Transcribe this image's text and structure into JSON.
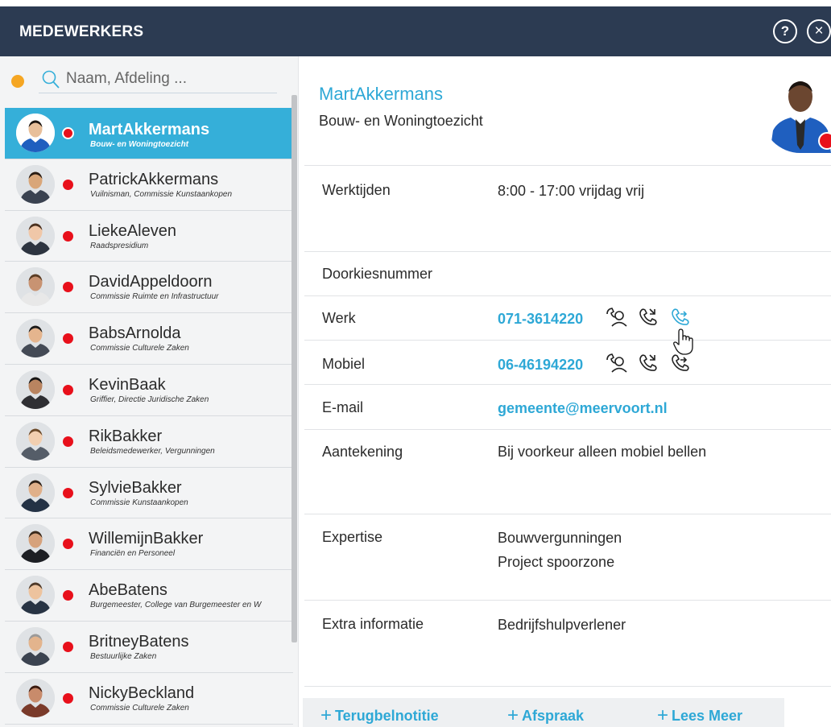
{
  "header": {
    "title": "MEDEWERKERS",
    "help_icon": "question-icon",
    "close_icon": "close-icon",
    "help_glyph": "?",
    "close_glyph": "×"
  },
  "search": {
    "placeholder": "Naam, Afdeling ...",
    "status_color": "#f5a623"
  },
  "employees": [
    {
      "name": "MartAkkermans",
      "role": "Bouw- en Woningtoezicht",
      "selected": true,
      "avatar": "person-avatar-1"
    },
    {
      "name": "PatrickAkkermans",
      "role": "Vuilnisman, Commissie Kunstaankopen",
      "avatar": "person-avatar-2"
    },
    {
      "name": "LiekeAleven",
      "role": "Raadspresidium",
      "avatar": "person-avatar-3"
    },
    {
      "name": "DavidAppeldoorn",
      "role": "Commissie Ruimte en Infrastructuur",
      "avatar": "person-avatar-4"
    },
    {
      "name": "BabsArnolda",
      "role": "Commissie Culturele Zaken",
      "avatar": "person-avatar-5"
    },
    {
      "name": "KevinBaak",
      "role": "Griffier, Directie Juridische Zaken",
      "avatar": "person-avatar-6"
    },
    {
      "name": "RikBakker",
      "role": "Beleidsmedewerker, Vergunningen",
      "avatar": "person-avatar-7"
    },
    {
      "name": "SylvieBakker",
      "role": "Commissie Kunstaankopen",
      "avatar": "person-avatar-8"
    },
    {
      "name": "WillemijnBakker",
      "role": "Financiën en Personeel",
      "avatar": "person-avatar-9"
    },
    {
      "name": "AbeBatens",
      "role": "Burgemeester, College van Burgemeester en W",
      "avatar": "person-avatar-10"
    },
    {
      "name": "BritneyBatens",
      "role": "Bestuurlijke Zaken",
      "avatar": "person-avatar-11"
    },
    {
      "name": "NickyBeckland",
      "role": "Commissie Culturele Zaken",
      "avatar": "person-avatar-12"
    }
  ],
  "detail": {
    "name": "MartAkkermans",
    "department": "Bouw- en Woningtoezicht",
    "fields": {
      "werktijden": {
        "label": "Werktijden",
        "value": "8:00 - 17:00 vrijdag vrij"
      },
      "doorkies": {
        "label": "Doorkiesnummer"
      },
      "werk": {
        "label": "Werk",
        "value": "071-3614220"
      },
      "mobiel": {
        "label": "Mobiel",
        "value": "06-46194220"
      },
      "email": {
        "label": "E-mail",
        "value": "gemeente@meervoort.nl"
      },
      "aantekening": {
        "label": "Aantekening",
        "value": "Bij voorkeur alleen mobiel bellen"
      },
      "expertise": {
        "label": "Expertise",
        "value1": "Bouwvergunningen",
        "value2": "Project spoorzone"
      },
      "extra": {
        "label": "Extra informatie",
        "value": "Bedrijfshulpverlener"
      }
    }
  },
  "actions": {
    "plus_glyph": "+",
    "callback": "Terugbelnotitie",
    "appointment": "Afspraak",
    "more": "Lees Meer"
  },
  "colors": {
    "header_bg": "#2c3b52",
    "accent": "#2ea8d6",
    "selected_bg": "#35afd9",
    "presence_busy": "#e8101b"
  }
}
